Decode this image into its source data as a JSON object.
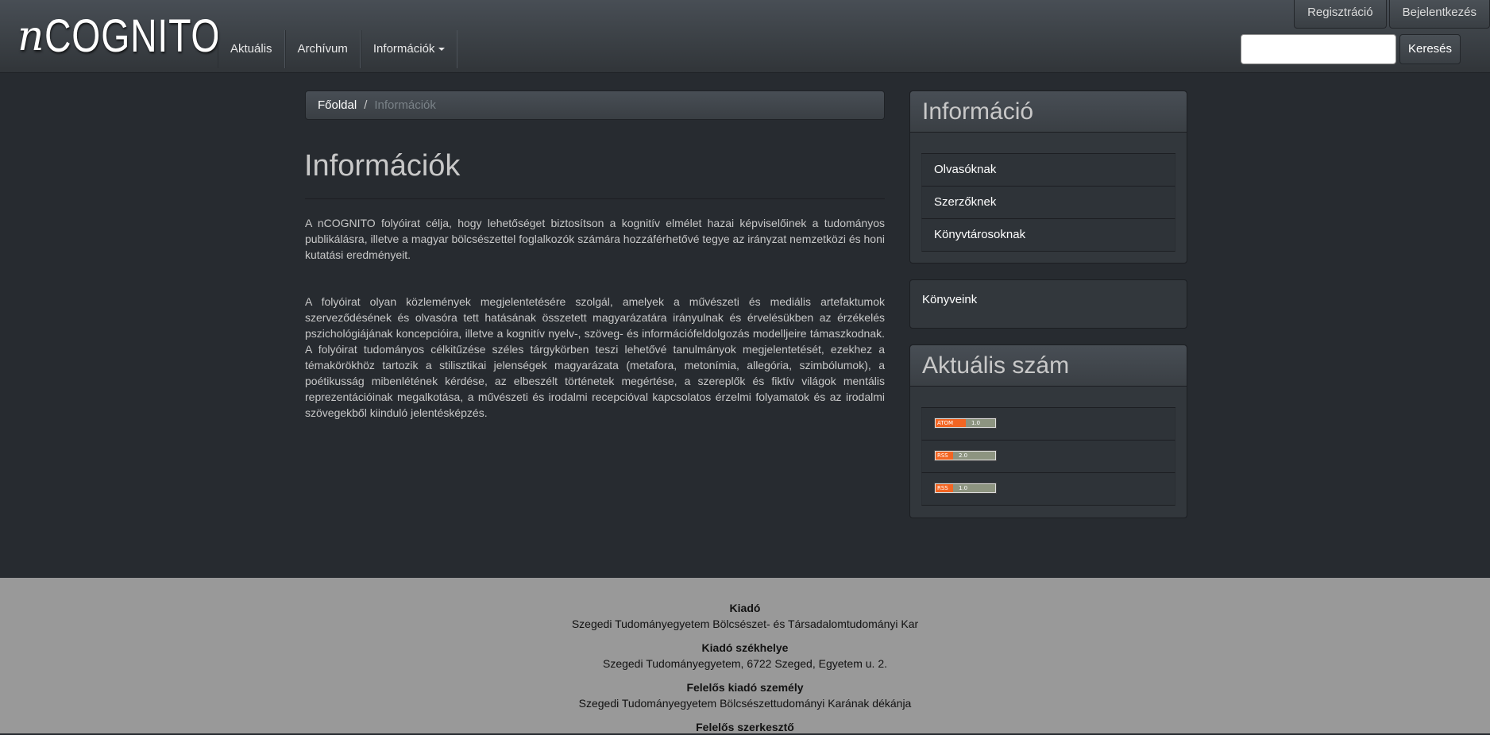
{
  "brand": {
    "n": "n",
    "rest": "COGNITO"
  },
  "nav": {
    "items": [
      "Aktuális",
      "Archívum",
      "Információk"
    ]
  },
  "top": {
    "register": "Regisztráció",
    "login": "Bejelentkezés"
  },
  "search": {
    "placeholder": "",
    "button": "Keresés"
  },
  "breadcrumb": {
    "home": "Főoldal",
    "sep": "/",
    "current": "Információk"
  },
  "main": {
    "title": "Információk",
    "paragraphs": [
      "A nCOGNITO folyóirat célja, hogy lehetőséget biztosítson a kognitív elmélet hazai képviselőinek a tudományos publikálásra, illetve a magyar bölcsészettel foglalkozók számára hozzáférhetővé tegye az irányzat nemzetközi és honi kutatási eredményeit.",
      "A folyóirat olyan közlemények megjelentetésére szolgál, amelyek a művészeti és mediális artefaktumok szerveződésének és olvasóra tett hatásának összetett magyarázatára irányulnak és érvelésükben az érzékelés pszichológiájának koncepcióira, illetve a kognitív nyelv-, szöveg- és információfeldolgozás modelljeire támaszkodnak. A folyóirat tudományos célkitűzése széles tárgykörben teszi lehetővé tanulmányok megjelentetését, ezekhez a témakörökhöz tartozik a stilisztikai jelenségek magyarázata (metafora, metonímia, allegória, szimbólumok), a poétikusság mibenlétének kérdése, az elbeszélt történetek megértése, a szereplők és fiktív világok mentális reprezentációinak megalkotása, a művészeti és irodalmi recepcióval kapcsolatos érzelmi folyamatok és az irodalmi szövegekből kiinduló jelentésképzés."
    ]
  },
  "sidebar": {
    "info_title": "Információ",
    "info_items": [
      "Olvasóknak",
      "Szerzőknek",
      "Könyvtárosoknak"
    ],
    "books": "Könyveink",
    "current_title": "Aktuális szám",
    "feeds": [
      {
        "left": "ATOM",
        "right": "1.0"
      },
      {
        "left": "RSS",
        "right": "2.0"
      },
      {
        "left": "RSS",
        "right": "1.0"
      }
    ]
  },
  "footer": {
    "blocks": [
      {
        "label": "Kiadó",
        "value": "Szegedi Tudományegyetem Bölcsészet- és Társadalomtudományi Kar"
      },
      {
        "label": "Kiadó székhelye",
        "value": "Szegedi Tudományegyetem, 6722 Szeged, Egyetem u. 2."
      },
      {
        "label": "Felelős kiadó személy",
        "value": "Szegedi Tudományegyetem Bölcsészettudományi Karának dékánja"
      },
      {
        "label": "Felelős szerkesztő",
        "value": ""
      }
    ]
  }
}
